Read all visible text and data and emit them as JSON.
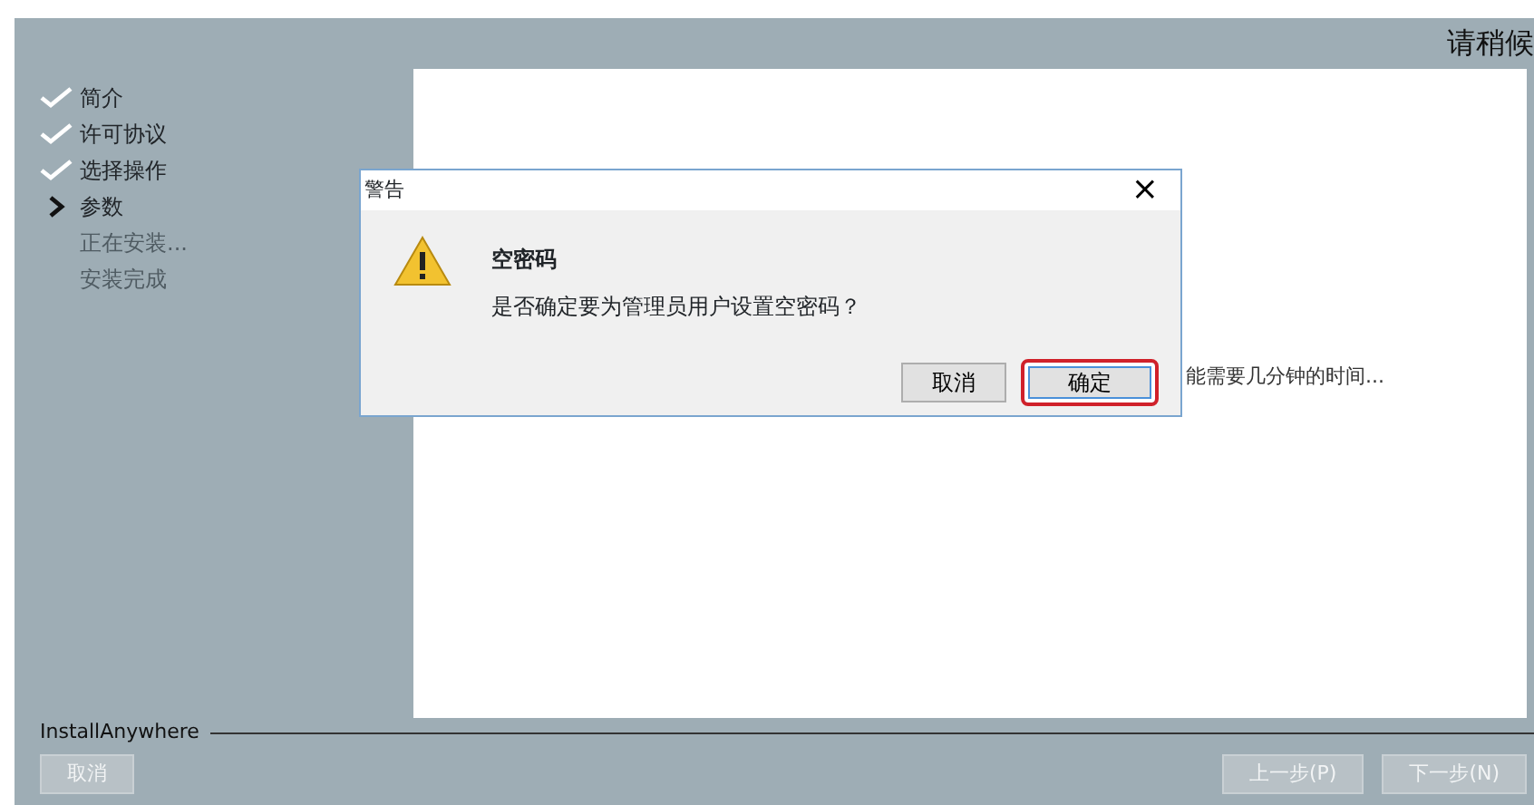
{
  "header": {
    "title": "请稍候"
  },
  "steps": [
    {
      "label": "简介",
      "kind": "done"
    },
    {
      "label": "许可协议",
      "kind": "done"
    },
    {
      "label": "选择操作",
      "kind": "done"
    },
    {
      "label": "参数",
      "kind": "current"
    },
    {
      "label": "正在安装...",
      "kind": "pending"
    },
    {
      "label": "安装完成",
      "kind": "pending"
    }
  ],
  "content": {
    "text": "能需要几分钟的时间..."
  },
  "dialog": {
    "title": "警告",
    "close": "×",
    "heading": "空密码",
    "message": "是否确定要为管理员用户设置空密码？",
    "buttons": [
      {
        "label": "取消",
        "highlighted": false
      },
      {
        "label": "确定",
        "highlighted": true
      }
    ]
  },
  "footer": {
    "brand": "InstallAnywhere",
    "buttons": [
      {
        "label": "取消",
        "disabled": true
      },
      {
        "label": "上一步(P)",
        "disabled": true
      },
      {
        "label": "下一步(N)",
        "disabled": true
      }
    ]
  }
}
